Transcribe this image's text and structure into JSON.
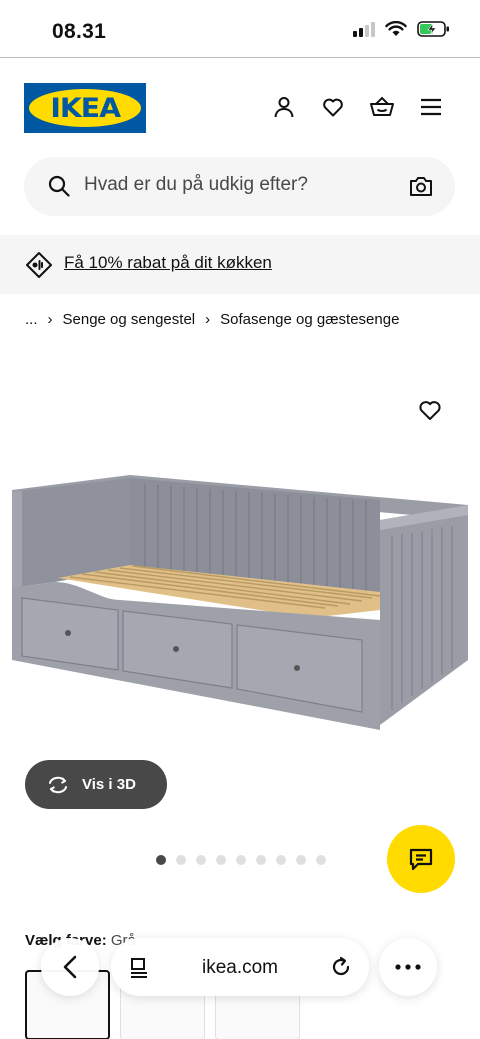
{
  "status_bar": {
    "time": "08.31"
  },
  "header": {
    "logo_text": "IKEA",
    "brand_colors": {
      "blue": "#0058a3",
      "yellow": "#ffdb00"
    },
    "icons": [
      "user-icon",
      "heart-icon",
      "basket-icon",
      "menu-icon"
    ]
  },
  "search": {
    "placeholder": "Hvad er du på udkig efter?"
  },
  "promo": {
    "text": "Få 10% rabat på dit køkken"
  },
  "breadcrumb": {
    "ellipsis": "...",
    "items": [
      "Senge og sengestel",
      "Sofasenge og gæstesenge"
    ]
  },
  "product": {
    "view_3d_label": "Vis i 3D",
    "image_count": 9,
    "active_image_index": 0,
    "color_label": "Vælg farve:",
    "color_value": "Grå"
  },
  "browser": {
    "url": "ikea.com"
  }
}
